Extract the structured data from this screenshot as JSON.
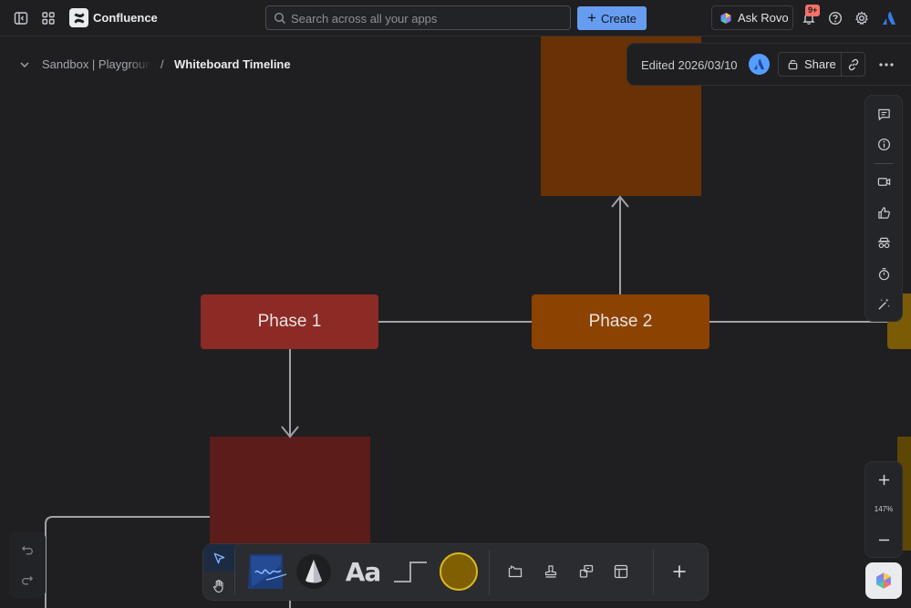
{
  "app": {
    "name": "Confluence",
    "search_placeholder": "Search across all your apps",
    "create_label": "Create",
    "ask_rovo_label": "Ask Rovo",
    "notifications_badge": "9+"
  },
  "breadcrumb": {
    "space": "Sandbox | Playground",
    "separator": "/",
    "page": "Whiteboard Timeline"
  },
  "page_header": {
    "edited": "Edited 2026/03/10",
    "share_label": "Share"
  },
  "canvas": {
    "shapes": [
      {
        "label": "Phase 1",
        "color": "#8c2a25"
      },
      {
        "label": "Phase 2",
        "color": "#8c4302"
      }
    ],
    "connector_color": "#9fa2a8"
  },
  "right_toolbar": {
    "icons": [
      "comment-icon",
      "info-icon",
      "video-icon",
      "thumbs-up-icon",
      "spy-icon",
      "timer-icon",
      "magic-wand-icon"
    ]
  },
  "zoom": {
    "level": "147%"
  },
  "bottom_toolbar": {
    "text_tool_label": "Aa",
    "tools": [
      "select-tool",
      "hand-tool",
      "pen-tool",
      "shape-cone-tool",
      "text-tool",
      "connector-tool",
      "circle-shape-tool",
      "frame-icon",
      "stamp-icon",
      "shapes-icon",
      "template-icon",
      "plus-icon"
    ],
    "circle_color": "#7f5f01"
  },
  "colors": {
    "accent": "#669df1",
    "background": "#1f1f21",
    "badge": "#f87168"
  }
}
